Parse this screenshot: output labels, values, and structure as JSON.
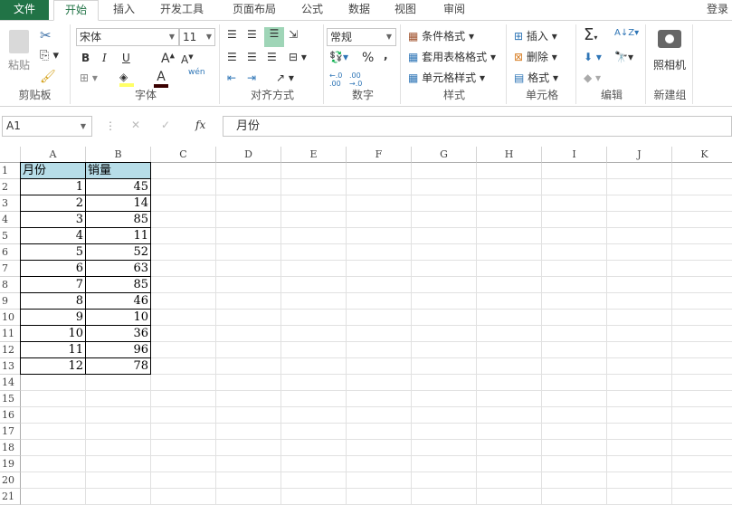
{
  "tabs": [
    "文件",
    "开始",
    "插入",
    "开发工具",
    "页面布局",
    "公式",
    "数据",
    "视图",
    "审阅"
  ],
  "login": "登录",
  "ribbon": {
    "clipboard": {
      "label": "剪贴板",
      "paste": "粘贴"
    },
    "font": {
      "label": "字体",
      "name": "宋体",
      "size": "11",
      "bold": "B",
      "italic": "I",
      "underline": "U",
      "phonetic": "wén",
      "fill_color": "#ffff66",
      "font_color": "#c00000"
    },
    "alignment": {
      "label": "对齐方式"
    },
    "number": {
      "label": "数字",
      "format": "常规",
      "percent": "%",
      "comma": ","
    },
    "styles": {
      "label": "样式",
      "items": [
        "条件格式",
        "套用表格格式",
        "单元格样式"
      ]
    },
    "cells": {
      "label": "单元格",
      "items": [
        "插入",
        "删除",
        "格式"
      ]
    },
    "editing": {
      "label": "编辑"
    },
    "newgroup": {
      "label": "新建组",
      "camera": "照相机"
    }
  },
  "formula_bar": {
    "name_box": "A1",
    "fx": "fx",
    "content": "月份"
  },
  "sheet": {
    "columns": [
      "A",
      "B",
      "C",
      "D",
      "E",
      "F",
      "G",
      "H",
      "I",
      "J",
      "K"
    ],
    "rows": 21,
    "headers": [
      "月份",
      "销量"
    ],
    "data": [
      [
        1,
        45
      ],
      [
        2,
        14
      ],
      [
        3,
        85
      ],
      [
        4,
        11
      ],
      [
        5,
        52
      ],
      [
        6,
        63
      ],
      [
        7,
        85
      ],
      [
        8,
        46
      ],
      [
        9,
        10
      ],
      [
        10,
        36
      ],
      [
        11,
        96
      ],
      [
        12,
        78
      ]
    ],
    "header_fill": "#b7dde8"
  }
}
